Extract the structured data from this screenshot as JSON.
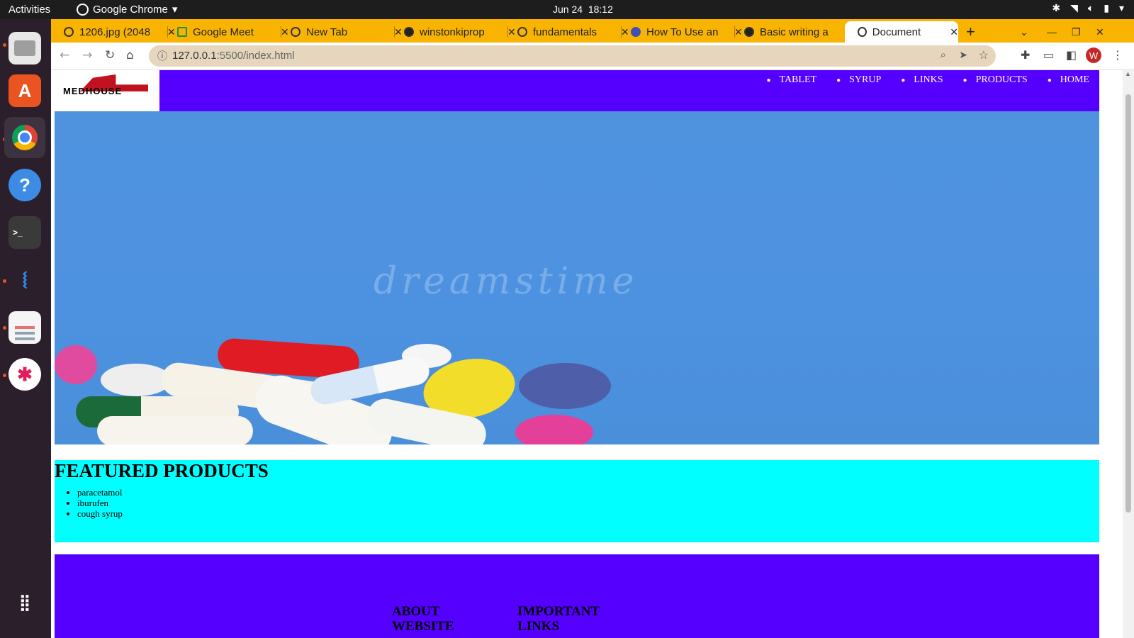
{
  "system_bar": {
    "activities": "Activities",
    "app_name": "Google Chrome",
    "date": "Jun 24",
    "time": "18:12"
  },
  "dock": {
    "apps": [
      "Files",
      "Ubuntu Software",
      "Google Chrome",
      "Help",
      "Terminal",
      "Visual Studio Code",
      "Document Viewer",
      "Slack",
      "Show Applications"
    ]
  },
  "browser": {
    "tabs": [
      {
        "title": "1206.jpg (2048"
      },
      {
        "title": "Google Meet"
      },
      {
        "title": "New Tab"
      },
      {
        "title": "winstonkiprop"
      },
      {
        "title": "fundamentals"
      },
      {
        "title": "How To Use an"
      },
      {
        "title": "Basic writing a"
      },
      {
        "title": "Document"
      }
    ],
    "new_tab": "+",
    "url_host": "127.0.0.1",
    "url_rest": ":5500/index.html",
    "profile_initial": "W"
  },
  "page": {
    "logo_text": "MEDHOUSE",
    "nav": [
      "TABLET",
      "SYRUP",
      "LINKS",
      "PRODUCTS",
      "HOME"
    ],
    "hero_watermark": "dreamstime",
    "featured_title": "FEATURED PRODUCTS",
    "featured_items": [
      "paracetamol",
      "iburufen",
      "cough syrup"
    ],
    "footer_col1": "ABOUT WEBSITE",
    "footer_col2": "IMPORTANT LINKS"
  }
}
